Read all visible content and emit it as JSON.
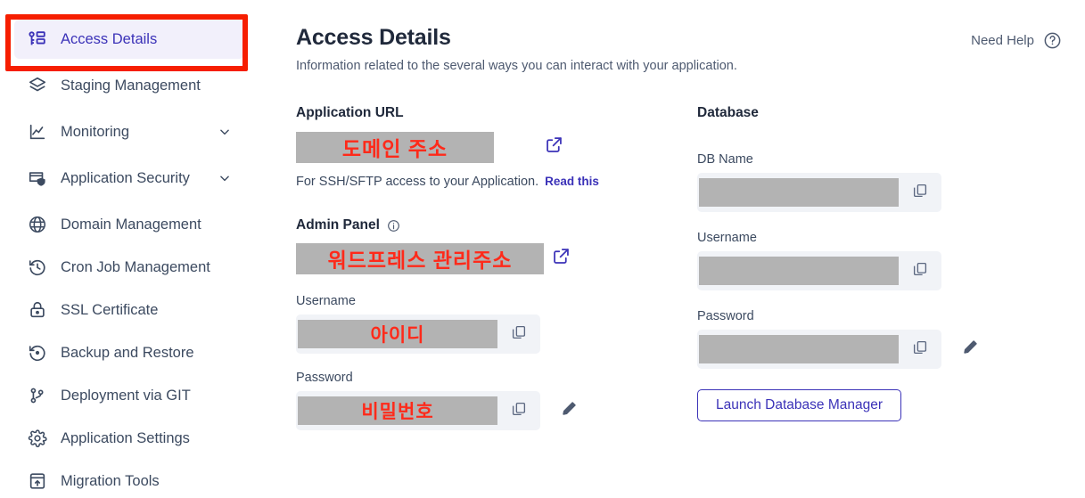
{
  "colors": {
    "accent": "#3b32b8",
    "highlight_box": "#f61e00",
    "redaction_bg": "#b3b3b3",
    "redaction_text": "#ff2a1a",
    "sidebar_active_bg": "#f2f0fb",
    "text_primary": "#20293b",
    "text_secondary": "#4e5a70",
    "field_bg": "#f1f3f7"
  },
  "sidebar": {
    "items": [
      {
        "label": "Access Details",
        "icon": "key-list-icon",
        "active": true,
        "expandable": false
      },
      {
        "label": "Staging Management",
        "icon": "layers-icon",
        "active": false,
        "expandable": false
      },
      {
        "label": "Monitoring",
        "icon": "chart-line-icon",
        "active": false,
        "expandable": true
      },
      {
        "label": "Application Security",
        "icon": "browser-shield-icon",
        "active": false,
        "expandable": true
      },
      {
        "label": "Domain Management",
        "icon": "globe-www-icon",
        "active": false,
        "expandable": false
      },
      {
        "label": "Cron Job Management",
        "icon": "clock-rotate-icon",
        "active": false,
        "expandable": false
      },
      {
        "label": "SSL Certificate",
        "icon": "lock-icon",
        "active": false,
        "expandable": false
      },
      {
        "label": "Backup and Restore",
        "icon": "restore-arrow-icon",
        "active": false,
        "expandable": false
      },
      {
        "label": "Deployment via GIT",
        "icon": "git-branch-icon",
        "active": false,
        "expandable": false
      },
      {
        "label": "Application Settings",
        "icon": "gear-icon",
        "active": false,
        "expandable": false
      },
      {
        "label": "Migration Tools",
        "icon": "migration-upload-icon",
        "active": false,
        "expandable": false
      }
    ]
  },
  "header": {
    "title": "Access Details",
    "subtitle": "Information related to the several ways you can interact with your application.",
    "need_help_label": "Need Help",
    "need_help_icon": "question-circle-icon"
  },
  "application": {
    "url_section_title": "Application URL",
    "url_value": "도메인 주소",
    "url_open_icon": "external-link-icon",
    "ssh_hint_text": "For SSH/SFTP access to your Application.",
    "ssh_hint_link": "Read this",
    "admin_panel_title": "Admin Panel",
    "admin_panel_info_icon": "info-circle-icon",
    "admin_panel_value": "워드프레스 관리주소",
    "admin_panel_open_icon": "external-link-icon",
    "username_label": "Username",
    "username_value": "아이디",
    "username_copy_icon": "copy-icon",
    "password_label": "Password",
    "password_value": "비밀번호",
    "password_copy_icon": "copy-icon",
    "password_edit_icon": "pencil-icon"
  },
  "database": {
    "section_title": "Database",
    "db_name_label": "DB Name",
    "db_name_value": "",
    "db_name_copy_icon": "copy-icon",
    "username_label": "Username",
    "username_value": "",
    "username_copy_icon": "copy-icon",
    "password_label": "Password",
    "password_value": "",
    "password_copy_icon": "copy-icon",
    "password_edit_icon": "pencil-icon",
    "launch_button_label": "Launch Database Manager"
  }
}
